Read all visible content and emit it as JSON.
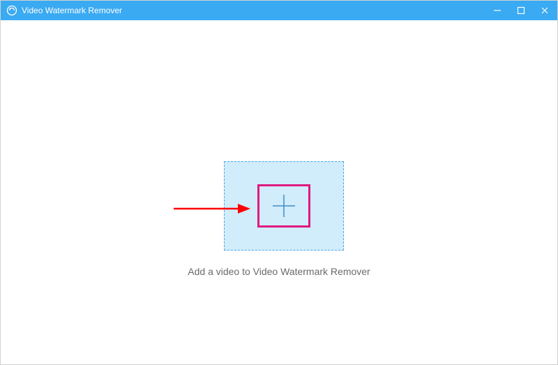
{
  "app": {
    "title": "Video Watermark Remover",
    "icon_name": "app-logo-icon"
  },
  "main": {
    "instruction": "Add a video to Video Watermark Remover",
    "add_icon_name": "plus-icon"
  },
  "colors": {
    "titlebar": "#3aaaf2",
    "dropzone_bg": "#d1ecfb",
    "dropzone_border": "#4aa9e6",
    "highlight": "#e0197f",
    "arrow": "#ff0000"
  }
}
